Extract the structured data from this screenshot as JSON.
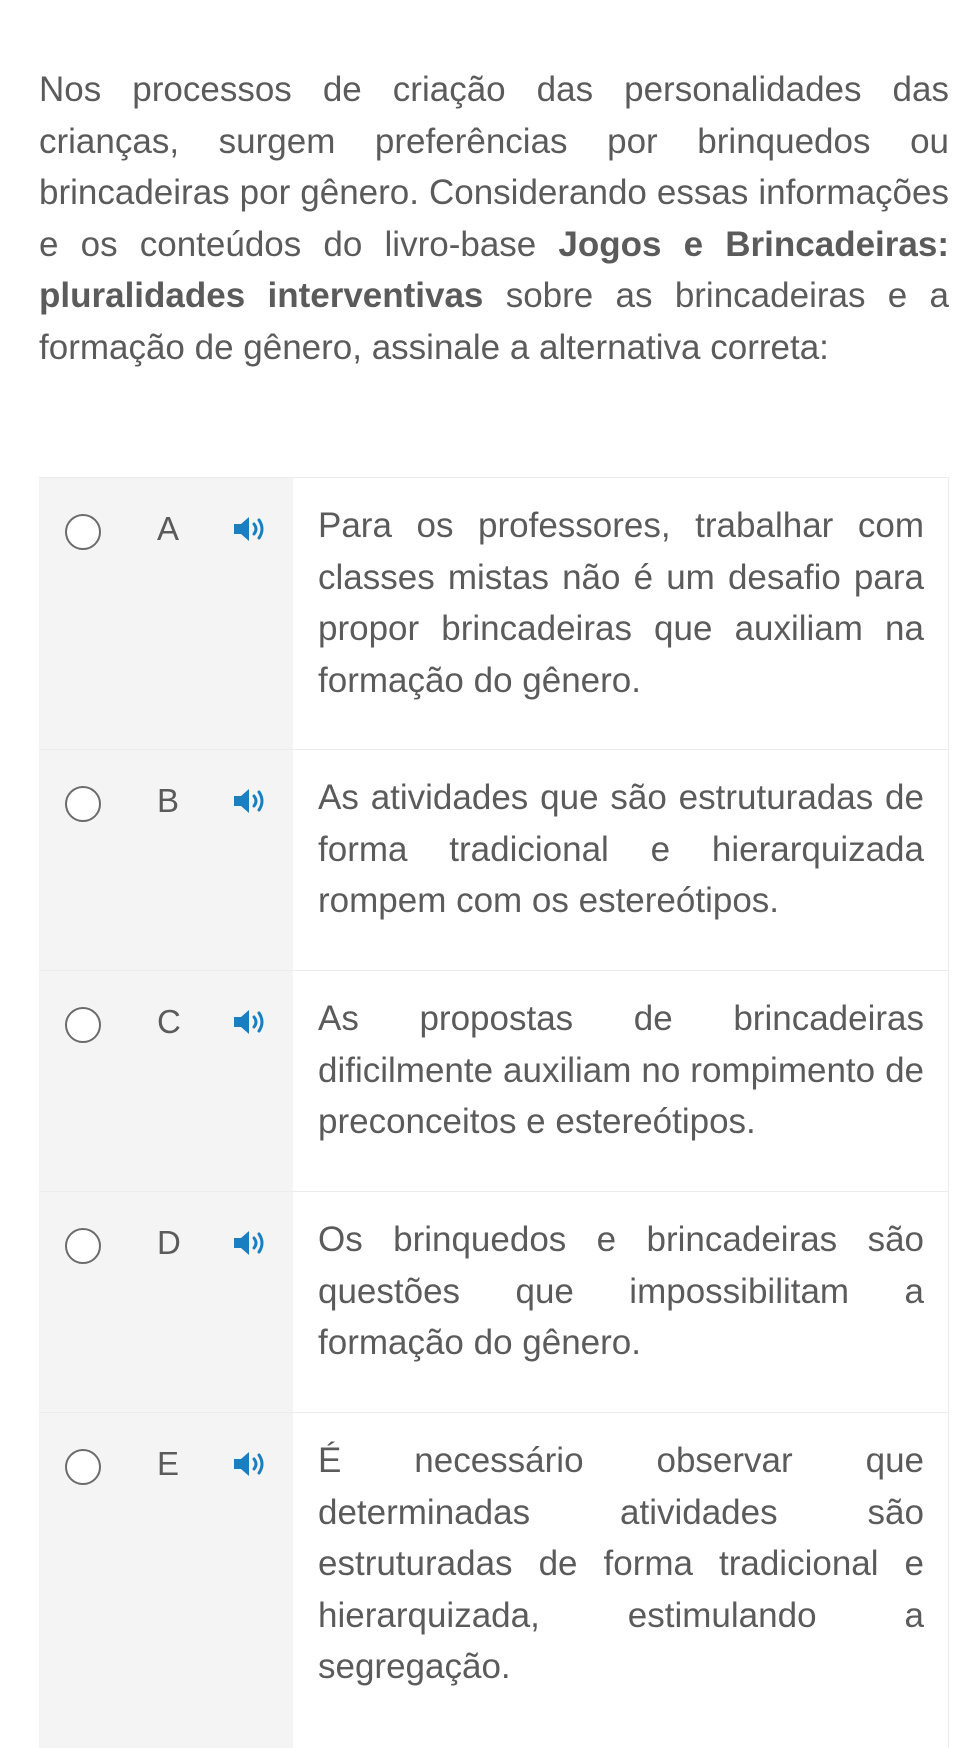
{
  "question": {
    "text_before": "Nos processos de criação das personalidades das crianças, surgem preferências por brinquedos ou brincadeiras por gênero. Considerando essas informações e os conteúdos do livro-base ",
    "book_title": "Jogos e Brincadeiras: pluralidades interventivas",
    "text_after": " sobre as brincadeiras e a formação de gênero, assinale a alternativa correta:"
  },
  "options": [
    {
      "letter": "A",
      "text": "Para os professores, trabalhar com classes mistas não é um desafio para propor brincadeiras que auxiliam na formação do gênero.",
      "icon": "speaker-icon"
    },
    {
      "letter": "B",
      "text": "As atividades que são estruturadas de forma tradicional e hierarquizada rompem com os estereótipos.",
      "icon": "speaker-icon"
    },
    {
      "letter": "C",
      "text": "As propostas de brincadeiras dificilmente auxiliam no rompimento de preconceitos e estereótipos.",
      "icon": "speaker-icon"
    },
    {
      "letter": "D",
      "text": "Os brinquedos e brincadeiras são questões que impossibilitam a formação do gênero.",
      "icon": "speaker-icon"
    },
    {
      "letter": "E",
      "text": "É necessário observar que determinadas atividades são estruturadas de forma tradicional e hierarquizada, estimulando a segregação.",
      "icon": "speaker-icon"
    }
  ],
  "colors": {
    "text": "#5b5b5b",
    "option_left_bg": "#f4f4f4",
    "speaker_icon": "#1a7fc1",
    "border": "#ececec"
  }
}
